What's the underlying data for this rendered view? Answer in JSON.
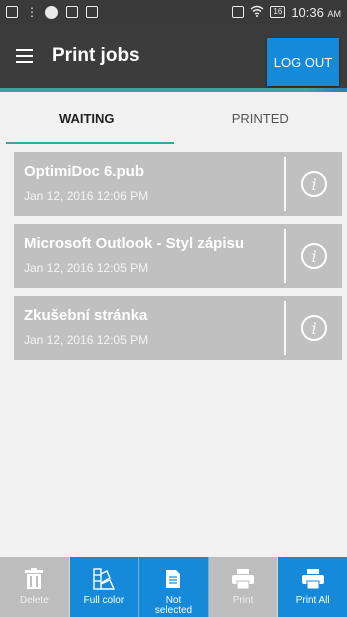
{
  "status_bar": {
    "time": "10:36",
    "ampm": "AM",
    "battery": "16"
  },
  "app_bar": {
    "title": "Print jobs",
    "logout_label": "LOG OUT"
  },
  "tabs": [
    {
      "label": "WAITING",
      "active": true
    },
    {
      "label": "PRINTED",
      "active": false
    }
  ],
  "jobs": [
    {
      "name": "OptimiDoc 6.pub",
      "date": "Jan 12, 2016 12:06 PM"
    },
    {
      "name": "Microsoft Outlook - Styl zápisu",
      "date": "Jan 12, 2016 12:05 PM"
    },
    {
      "name": "Zkušební stránka",
      "date": "Jan 12, 2016 12:05 PM"
    }
  ],
  "toolbar": {
    "delete_label": "Delete",
    "color_label": "Full color",
    "selection_label_1": "Not",
    "selection_label_2": "selected",
    "print_label": "Print",
    "print_all_label": "Print All"
  },
  "colors": {
    "accent_blue": "#1689d8",
    "accent_teal": "#3aa5a0",
    "app_bar": "#3c3c3c",
    "job_card": "#c0c0c0",
    "disabled": "#bdbdbd"
  },
  "icons": [
    "menu-icon",
    "info-icon",
    "trash-icon",
    "color-palette-icon",
    "document-icon",
    "printer-icon"
  ]
}
